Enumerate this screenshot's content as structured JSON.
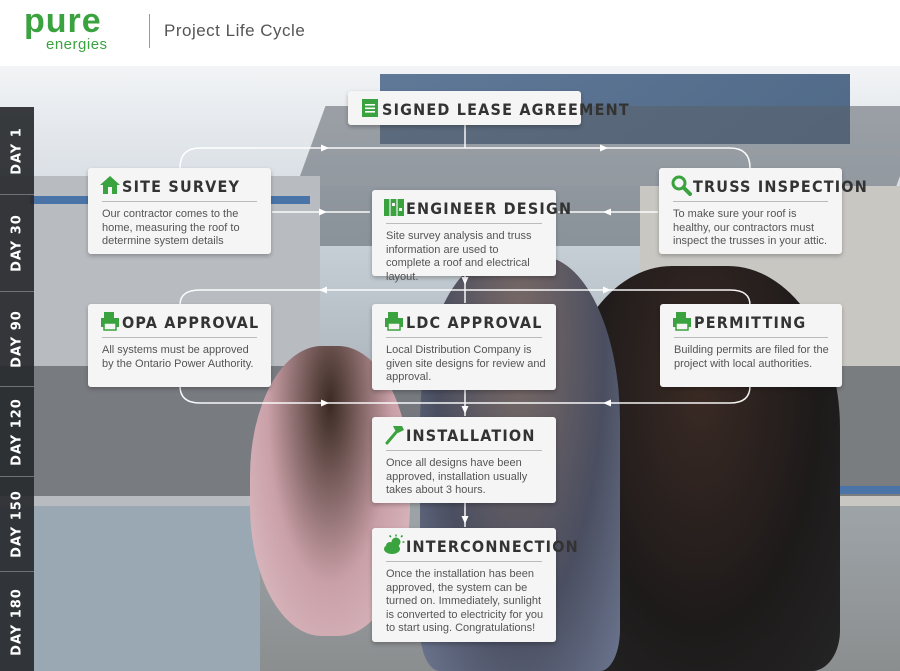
{
  "header": {
    "logo_main": "pure",
    "logo_sub": "energies",
    "title": "Project Life Cycle"
  },
  "timeline": [
    "DAY 1",
    "DAY 30",
    "DAY 90",
    "DAY 120",
    "DAY 150",
    "DAY 180"
  ],
  "steps": {
    "signed_lease": {
      "title": "SIGNED LEASE AGREEMENT",
      "icon": "document-icon"
    },
    "site_survey": {
      "title": "SITE SURVEY",
      "desc": "Our contractor comes to the home, measuring the roof to determine system details",
      "icon": "house-icon"
    },
    "engineer_design": {
      "title": "ENGINEER DESIGN",
      "desc": "Site survey analysis and truss information are used to complete a roof and electrical layout.",
      "icon": "blueprint-icon"
    },
    "truss_inspection": {
      "title": "TRUSS INSPECTION",
      "desc": "To make sure your roof is healthy, our contractors must inspect the trusses in your attic.",
      "icon": "magnifier-icon"
    },
    "opa_approval": {
      "title": "OPA APPROVAL",
      "desc": "All systems must be approved by the Ontario Power Authority.",
      "icon": "printer-icon"
    },
    "ldc_approval": {
      "title": "LDC APPROVAL",
      "desc": "Local Distribution Company is given site designs for review and approval.",
      "icon": "printer-icon"
    },
    "permitting": {
      "title": "PERMITTING",
      "desc": "Building permits are filed for the project with local authorities.",
      "icon": "printer-icon"
    },
    "installation": {
      "title": "INSTALLATION",
      "desc": "Once all designs have been approved, installation usually takes about 3 hours.",
      "icon": "hammer-icon"
    },
    "interconnection": {
      "title": "INTERCONNECTION",
      "desc": "Once the installation has been approved, the system can be turned on. Immediately, sunlight is converted to electricity for you to start using. Congratulations!",
      "icon": "sun-cloud-icon"
    }
  },
  "colors": {
    "brand_green": "#3aa33f",
    "timeline_bg": "#282a2e",
    "card_bg": "#f5f5f5",
    "connector": "#ffffff"
  }
}
